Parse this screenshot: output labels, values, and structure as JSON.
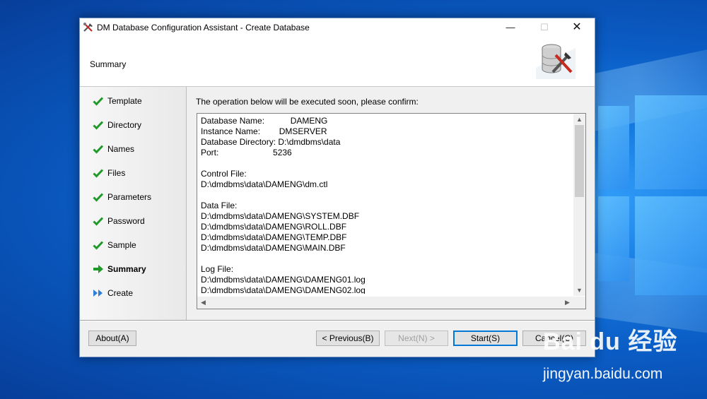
{
  "window": {
    "title": "DM Database Configuration Assistant - Create Database",
    "minimize": "—",
    "maximize": "☐",
    "close": "✕"
  },
  "header": {
    "title": "Summary"
  },
  "steps": [
    {
      "label": "Template",
      "state": "done"
    },
    {
      "label": "Directory",
      "state": "done"
    },
    {
      "label": "Names",
      "state": "done"
    },
    {
      "label": "Files",
      "state": "done"
    },
    {
      "label": "Parameters",
      "state": "done"
    },
    {
      "label": "Password",
      "state": "done"
    },
    {
      "label": "Sample",
      "state": "done"
    },
    {
      "label": "Summary",
      "state": "current"
    },
    {
      "label": "Create",
      "state": "pending"
    }
  ],
  "main": {
    "prompt": "The operation below will be executed soon, please confirm:",
    "summary_lines": [
      "Database Name:           DAMENG",
      "Instance Name:        DMSERVER",
      "Database Directory: D:\\dmdbms\\data",
      "Port:                       5236",
      "",
      "Control File:",
      "D:\\dmdbms\\data\\DAMENG\\dm.ctl",
      "",
      "Data File:",
      "D:\\dmdbms\\data\\DAMENG\\SYSTEM.DBF",
      "D:\\dmdbms\\data\\DAMENG\\ROLL.DBF",
      "D:\\dmdbms\\data\\DAMENG\\TEMP.DBF",
      "D:\\dmdbms\\data\\DAMENG\\MAIN.DBF",
      "",
      "Log File:",
      "D:\\dmdbms\\data\\DAMENG\\DAMENG01.log",
      "D:\\dmdbms\\data\\DAMENG\\DAMENG02.log"
    ]
  },
  "buttons": {
    "about": "About(A)",
    "previous": "< Previous(B)",
    "next": "Next(N) >",
    "start": "Start(S)",
    "cancel": "Cancel(C)"
  },
  "watermark": {
    "logo": "Bai du 经验",
    "url": "jingyan.baidu.com"
  },
  "colors": {
    "check": "#1f9a2a",
    "current_arrow": "#1f9a2a",
    "pending_arrow": "#2f7fd6",
    "focus_border": "#0078d7"
  }
}
